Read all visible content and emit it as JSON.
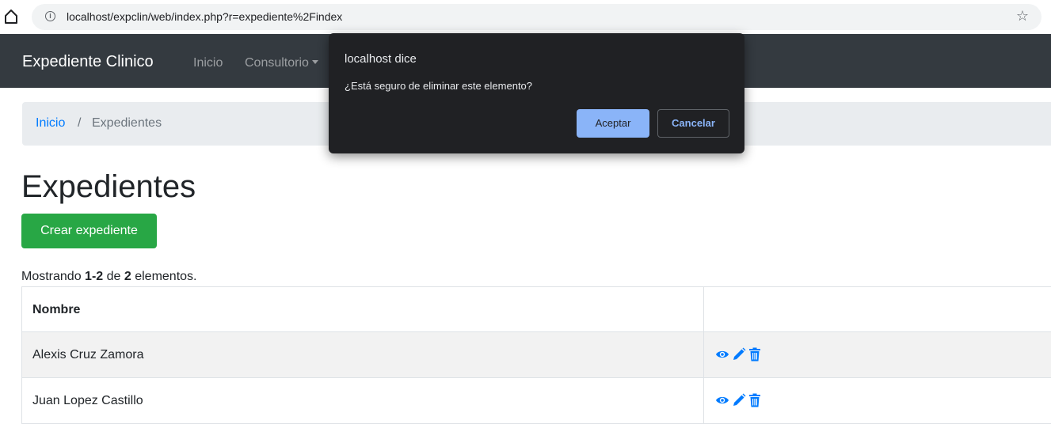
{
  "browser": {
    "url": "localhost/expclin/web/index.php?r=expediente%2Findex",
    "info_glyph": "i",
    "star_glyph": "☆"
  },
  "navbar": {
    "brand": "Expediente Clinico",
    "items": [
      {
        "label": "Inicio"
      },
      {
        "label": "Consultorio"
      }
    ]
  },
  "breadcrumb": {
    "home": "Inicio",
    "separator": "/",
    "current": "Expedientes"
  },
  "page": {
    "title": "Expedientes",
    "create_button": "Crear expediente"
  },
  "summary": {
    "prefix": "Mostrando ",
    "range": "1-2",
    "middle": " de ",
    "total": "2",
    "suffix": " elementos."
  },
  "table": {
    "columns": [
      "Nombre",
      ""
    ],
    "rows": [
      {
        "nombre": "Alexis Cruz Zamora",
        "actions": [
          "eye-icon",
          "pencil-icon",
          "trash-icon"
        ]
      },
      {
        "nombre": "Juan Lopez Castillo",
        "actions": [
          "eye-icon",
          "pencil-icon",
          "trash-icon"
        ]
      }
    ]
  },
  "dialog": {
    "title": "localhost dice",
    "message": "¿Está seguro de eliminar este elemento?",
    "ok_label": "Aceptar",
    "cancel_label": "Cancelar"
  },
  "colors": {
    "navbar": "#343a40",
    "primary_link": "#007bff",
    "success": "#28a745",
    "dialog_bg": "#202124",
    "dialog_accent": "#8ab4f8"
  }
}
